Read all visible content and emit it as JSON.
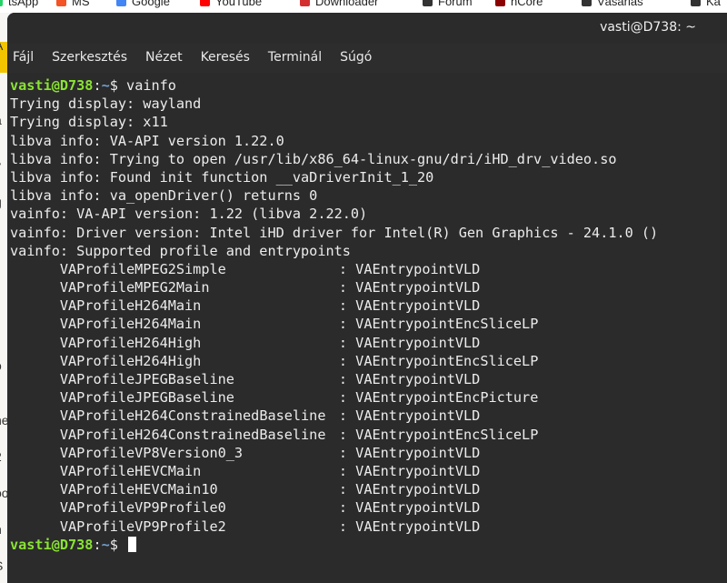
{
  "background": {
    "bookmarks": [
      {
        "label": "tsApp",
        "icon": "whatsapp-icon",
        "color": "#25d366"
      },
      {
        "label": "MS",
        "icon": "microsoft-icon",
        "color": "#f35325"
      },
      {
        "label": "Google",
        "icon": "google-icon",
        "color": "#4285f4"
      },
      {
        "label": "YouTube",
        "icon": "youtube-icon",
        "color": "#ff0000"
      },
      {
        "label": "Downloader",
        "icon": "download-icon",
        "color": "#d32f2f"
      },
      {
        "label": "Forum",
        "icon": "forum-icon",
        "color": "#333333"
      },
      {
        "label": "nCore",
        "icon": "ncore-icon",
        "color": "#8b0000"
      },
      {
        "label": "Vásárlás",
        "icon": "folder-icon",
        "color": "#333333"
      },
      {
        "label": "Ka",
        "icon": "folder-icon",
        "color": "#333333"
      }
    ],
    "left_fragments": [
      "A",
      "a",
      "y",
      "g",
      "r",
      "t",
      "ö",
      "he",
      "2",
      "oo",
      "n",
      "S"
    ]
  },
  "window": {
    "title": "vasti@D738: ~",
    "accent": "#8ae234",
    "path_color": "#729fcf"
  },
  "menu": [
    "Fájl",
    "Szerkesztés",
    "Nézet",
    "Keresés",
    "Terminál",
    "Súgó"
  ],
  "prompt": {
    "user": "vasti@D738",
    "sep": ":",
    "path": "~",
    "symbol": "$ "
  },
  "command": "vainfo",
  "output_lines": [
    "Trying display: wayland",
    "Trying display: x11",
    "libva info: VA-API version 1.22.0",
    "libva info: Trying to open /usr/lib/x86_64-linux-gnu/dri/iHD_drv_video.so",
    "libva info: Found init function __vaDriverInit_1_20",
    "libva info: va_openDriver() returns 0",
    "vainfo: VA-API version: 1.22 (libva 2.22.0)",
    "vainfo: Driver version: Intel iHD driver for Intel(R) Gen Graphics - 24.1.0 ()",
    "vainfo: Supported profile and entrypoints"
  ],
  "profiles": [
    {
      "profile": "VAProfileMPEG2Simple",
      "entrypoint": "VAEntrypointVLD"
    },
    {
      "profile": "VAProfileMPEG2Main",
      "entrypoint": "VAEntrypointVLD"
    },
    {
      "profile": "VAProfileH264Main",
      "entrypoint": "VAEntrypointVLD"
    },
    {
      "profile": "VAProfileH264Main",
      "entrypoint": "VAEntrypointEncSliceLP"
    },
    {
      "profile": "VAProfileH264High",
      "entrypoint": "VAEntrypointVLD"
    },
    {
      "profile": "VAProfileH264High",
      "entrypoint": "VAEntrypointEncSliceLP"
    },
    {
      "profile": "VAProfileJPEGBaseline",
      "entrypoint": "VAEntrypointVLD"
    },
    {
      "profile": "VAProfileJPEGBaseline",
      "entrypoint": "VAEntrypointEncPicture"
    },
    {
      "profile": "VAProfileH264ConstrainedBaseline",
      "entrypoint": "VAEntrypointVLD"
    },
    {
      "profile": "VAProfileH264ConstrainedBaseline",
      "entrypoint": "VAEntrypointEncSliceLP"
    },
    {
      "profile": "VAProfileVP8Version0_3",
      "entrypoint": "VAEntrypointVLD"
    },
    {
      "profile": "VAProfileHEVCMain",
      "entrypoint": "VAEntrypointVLD"
    },
    {
      "profile": "VAProfileHEVCMain10",
      "entrypoint": "VAEntrypointVLD"
    },
    {
      "profile": "VAProfileVP9Profile0",
      "entrypoint": "VAEntrypointVLD"
    },
    {
      "profile": "VAProfileVP9Profile2",
      "entrypoint": "VAEntrypointVLD"
    }
  ]
}
